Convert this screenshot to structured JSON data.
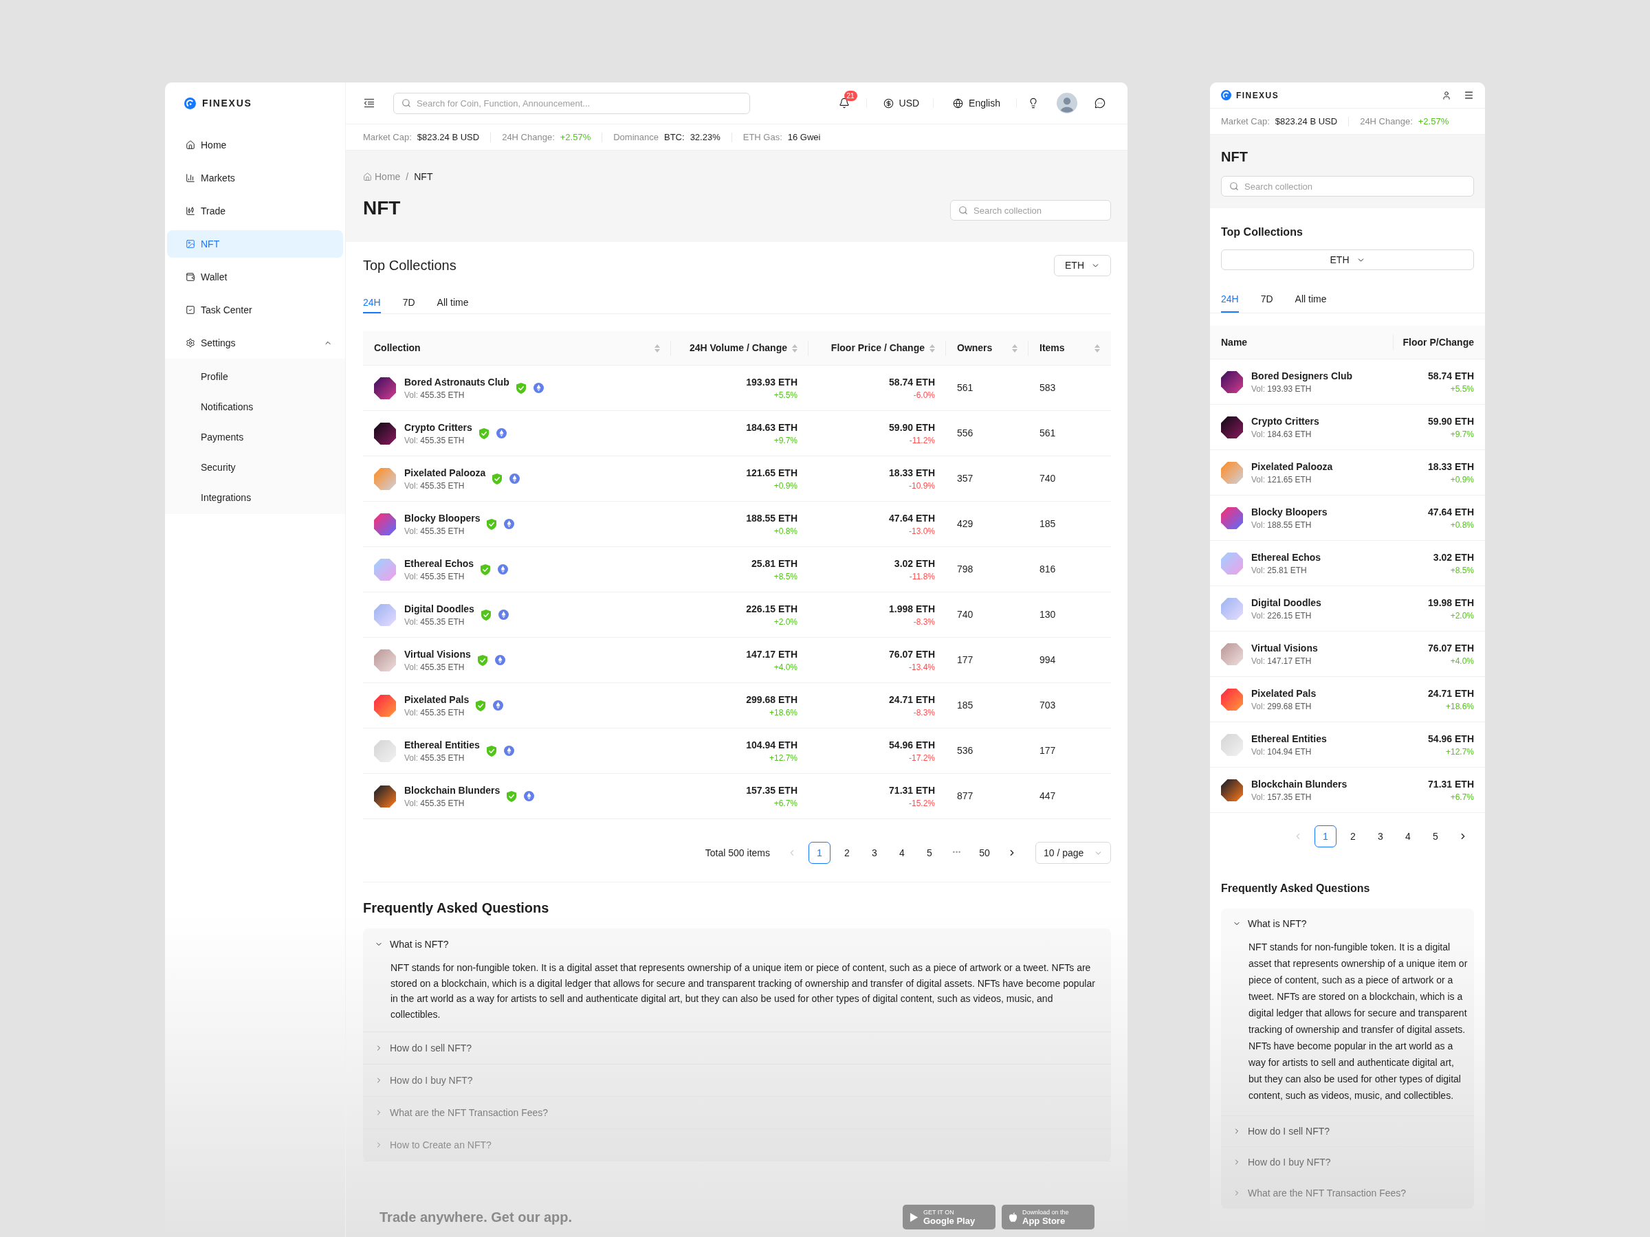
{
  "sidebar": {
    "brand": "FINEXUS",
    "items": [
      {
        "label": "Home",
        "selected": false
      },
      {
        "label": "Markets",
        "selected": false
      },
      {
        "label": "Trade",
        "selected": false
      },
      {
        "label": "NFT",
        "selected": true
      },
      {
        "label": "Wallet",
        "selected": false
      },
      {
        "label": "Task Center",
        "selected": false
      },
      {
        "label": "Settings",
        "selected": false,
        "expanded": true,
        "children": [
          {
            "label": "Profile",
            "selected": false
          },
          {
            "label": "Notifications",
            "selected": false
          },
          {
            "label": "Payments",
            "selected": false
          },
          {
            "label": "Security",
            "selected": false
          },
          {
            "label": "Integrations",
            "selected": false
          }
        ]
      }
    ]
  },
  "topbar": {
    "search": {
      "placeholder": "Search for Coin, Function, Announcement..."
    },
    "notification_count": "21",
    "currency": "USD",
    "language": "English"
  },
  "market_stats": [
    {
      "label": "Market Cap:",
      "value": "$823.24 B USD"
    },
    {
      "label": "24H Change:",
      "value": "+2.57%",
      "positive": true
    },
    {
      "label": "Dominance",
      "sublabel": "BTC:",
      "value": "32.23%"
    },
    {
      "label": "ETH Gas:",
      "value": "16 Gwei"
    }
  ],
  "breadcrumb": {
    "items": [
      {
        "label": "Home"
      },
      {
        "label": "NFT"
      }
    ],
    "separator": "/"
  },
  "page_title": "NFT",
  "collection_search": {
    "placeholder": "Search collection"
  },
  "top_collections": {
    "title": "Top Collections",
    "currency": "ETH",
    "tabs": [
      {
        "label": "24H",
        "selected": true
      },
      {
        "label": "7D",
        "selected": false
      },
      {
        "label": "All time",
        "selected": false
      }
    ],
    "table": {
      "columns": [
        "Collection",
        "24H Volume / Change",
        "Floor Price / Change",
        "Owners",
        "Items"
      ],
      "rows": [
        {
          "name": "Bored Astronauts Club",
          "vol_label": "Vol:",
          "vol": "455.35 ETH",
          "volume": "193.93 ETH",
          "volume_change": "+5.5%",
          "volume_positive": true,
          "floor": "58.74 ETH",
          "floor_change": "-6.0%",
          "floor_positive": false,
          "owners": "561",
          "items": "583"
        },
        {
          "name": "Crypto Critters",
          "vol_label": "Vol:",
          "vol": "455.35 ETH",
          "volume": "184.63 ETH",
          "volume_change": "+9.7%",
          "volume_positive": true,
          "floor": "59.90 ETH",
          "floor_change": "-11.2%",
          "floor_positive": false,
          "owners": "556",
          "items": "561"
        },
        {
          "name": "Pixelated Palooza",
          "vol_label": "Vol:",
          "vol": "455.35 ETH",
          "volume": "121.65 ETH",
          "volume_change": "+0.9%",
          "volume_positive": true,
          "floor": "18.33 ETH",
          "floor_change": "-10.9%",
          "floor_positive": false,
          "owners": "357",
          "items": "740"
        },
        {
          "name": "Blocky Bloopers",
          "vol_label": "Vol:",
          "vol": "455.35 ETH",
          "volume": "188.55 ETH",
          "volume_change": "+0.8%",
          "volume_positive": true,
          "floor": "47.64 ETH",
          "floor_change": "-13.0%",
          "floor_positive": false,
          "owners": "429",
          "items": "185"
        },
        {
          "name": "Ethereal Echos",
          "vol_label": "Vol:",
          "vol": "455.35 ETH",
          "volume": "25.81 ETH",
          "volume_change": "+8.5%",
          "volume_positive": true,
          "floor": "3.02 ETH",
          "floor_change": "-11.8%",
          "floor_positive": false,
          "owners": "798",
          "items": "816"
        },
        {
          "name": "Digital Doodles",
          "vol_label": "Vol:",
          "vol": "455.35 ETH",
          "volume": "226.15 ETH",
          "volume_change": "+2.0%",
          "volume_positive": true,
          "floor": "1.998 ETH",
          "floor_change": "-8.3%",
          "floor_positive": false,
          "owners": "740",
          "items": "130"
        },
        {
          "name": "Virtual Visions",
          "vol_label": "Vol:",
          "vol": "455.35 ETH",
          "volume": "147.17 ETH",
          "volume_change": "+4.0%",
          "volume_positive": true,
          "floor": "76.07 ETH",
          "floor_change": "-13.4%",
          "floor_positive": false,
          "owners": "177",
          "items": "994"
        },
        {
          "name": "Pixelated Pals",
          "vol_label": "Vol:",
          "vol": "455.35 ETH",
          "volume": "299.68 ETH",
          "volume_change": "+18.6%",
          "volume_positive": true,
          "floor": "24.71 ETH",
          "floor_change": "-8.3%",
          "floor_positive": false,
          "owners": "185",
          "items": "703"
        },
        {
          "name": "Ethereal Entities",
          "vol_label": "Vol:",
          "vol": "455.35 ETH",
          "volume": "104.94 ETH",
          "volume_change": "+12.7%",
          "volume_positive": true,
          "floor": "54.96 ETH",
          "floor_change": "-17.2%",
          "floor_positive": false,
          "owners": "536",
          "items": "177"
        },
        {
          "name": "Blockchain Blunders",
          "vol_label": "Vol:",
          "vol": "455.35 ETH",
          "volume": "157.35 ETH",
          "volume_change": "+6.7%",
          "volume_positive": true,
          "floor": "71.31 ETH",
          "floor_change": "-15.2%",
          "floor_positive": false,
          "owners": "877",
          "items": "447"
        }
      ]
    },
    "pagination": {
      "total": "Total 500 items",
      "prev_disabled": true,
      "next_disabled": false,
      "pages": [
        {
          "kind": "page",
          "label": "1",
          "selected": true
        },
        {
          "kind": "page",
          "label": "2",
          "selected": false
        },
        {
          "kind": "page",
          "label": "3",
          "selected": false
        },
        {
          "kind": "page",
          "label": "4",
          "selected": false
        },
        {
          "kind": "page",
          "label": "5",
          "selected": false
        },
        {
          "kind": "ellipsis",
          "label": "•••",
          "selected": false
        },
        {
          "kind": "page",
          "label": "50",
          "selected": false
        }
      ],
      "page_size": "10 / page"
    }
  },
  "faq": {
    "title": "Frequently Asked Questions",
    "items": [
      {
        "question": "What is NFT?",
        "expanded": true,
        "answer": "NFT stands for non-fungible token. It is a digital asset that represents ownership of a unique item or piece of content, such as a piece of artwork or a tweet. NFTs are stored on a blockchain, which is a digital ledger that allows for secure and transparent tracking of ownership and transfer of digital assets. NFTs have become popular in the art world as a way for artists to sell and authenticate digital art, but they can also be used for other types of digital content, such as videos, music, and collectibles."
      },
      {
        "question": "How do I sell NFT?",
        "expanded": false
      },
      {
        "question": "How do I buy NFT?",
        "expanded": false
      },
      {
        "question": "What are the NFT Transaction Fees?",
        "expanded": false
      },
      {
        "question": "How to Create an NFT?",
        "expanded": false
      }
    ]
  },
  "app_promo": {
    "text": "Trade anywhere. Get our app.",
    "badges": [
      {
        "kind": "google_play",
        "caption": "GET IT ON",
        "store": "Google Play"
      },
      {
        "kind": "app_store",
        "caption": "Download on the",
        "store": "App Store"
      }
    ]
  },
  "mobile": {
    "brand": "FINEXUS",
    "market_stats": [
      {
        "label": "Market Cap:",
        "value": "$823.24 B USD"
      },
      {
        "label": "24H Change:",
        "value": "+2.57%",
        "positive": true
      }
    ],
    "page_title": "NFT",
    "search": {
      "placeholder": "Search collection"
    },
    "top_collections": {
      "title": "Top Collections",
      "currency": "ETH",
      "tabs": [
        {
          "label": "24H",
          "selected": true
        },
        {
          "label": "7D",
          "selected": false
        },
        {
          "label": "All time",
          "selected": false
        }
      ],
      "columns": [
        "Name",
        "Floor P/Change"
      ],
      "rows": [
        {
          "name": "Bored Designers Club",
          "vol_label": "Vol:",
          "vol": "193.93 ETH",
          "floor": "58.74 ETH",
          "change": "+5.5%",
          "positive": true
        },
        {
          "name": "Crypto Critters",
          "vol_label": "Vol:",
          "vol": "184.63 ETH",
          "floor": "59.90 ETH",
          "change": "+9.7%",
          "positive": true
        },
        {
          "name": "Pixelated Palooza",
          "vol_label": "Vol:",
          "vol": "121.65 ETH",
          "floor": "18.33 ETH",
          "change": "+0.9%",
          "positive": true
        },
        {
          "name": "Blocky Bloopers",
          "vol_label": "Vol:",
          "vol": "188.55 ETH",
          "floor": "47.64 ETH",
          "change": "+0.8%",
          "positive": true
        },
        {
          "name": "Ethereal Echos",
          "vol_label": "Vol:",
          "vol": "25.81 ETH",
          "floor": "3.02 ETH",
          "change": "+8.5%",
          "positive": true
        },
        {
          "name": "Digital Doodles",
          "vol_label": "Vol:",
          "vol": "226.15 ETH",
          "floor": "19.98 ETH",
          "change": "+2.0%",
          "positive": true
        },
        {
          "name": "Virtual Visions",
          "vol_label": "Vol:",
          "vol": "147.17 ETH",
          "floor": "76.07 ETH",
          "change": "+4.0%",
          "positive": true
        },
        {
          "name": "Pixelated Pals",
          "vol_label": "Vol:",
          "vol": "299.68 ETH",
          "floor": "24.71 ETH",
          "change": "+18.6%",
          "positive": true
        },
        {
          "name": "Ethereal Entities",
          "vol_label": "Vol:",
          "vol": "104.94 ETH",
          "floor": "54.96 ETH",
          "change": "+12.7%",
          "positive": true
        },
        {
          "name": "Blockchain Blunders",
          "vol_label": "Vol:",
          "vol": "157.35 ETH",
          "floor": "71.31 ETH",
          "change": "+6.7%",
          "positive": true
        }
      ],
      "pagination": {
        "prev_disabled": true,
        "next_disabled": false,
        "pages": [
          {
            "kind": "page",
            "label": "1",
            "selected": true
          },
          {
            "kind": "page",
            "label": "2",
            "selected": false
          },
          {
            "kind": "page",
            "label": "3",
            "selected": false
          },
          {
            "kind": "page",
            "label": "4",
            "selected": false
          },
          {
            "kind": "page",
            "label": "5",
            "selected": false
          }
        ]
      }
    },
    "faq": {
      "title": "Frequently Asked Questions",
      "items": [
        {
          "question": "What is NFT?",
          "expanded": true,
          "answer": "NFT stands for non-fungible token. It is a digital asset that represents ownership of a unique item or piece of content, such as a piece of artwork or a tweet. NFTs are stored on a blockchain, which is a digital ledger that allows for secure and transparent tracking of ownership and transfer of digital assets. NFTs have become popular in the art world as a way for artists to sell and authenticate digital art, but they can also be used for other types of digital content, such as videos, music, and collectibles."
        },
        {
          "question": "How do I sell NFT?",
          "expanded": false
        },
        {
          "question": "How do I buy NFT?",
          "expanded": false
        },
        {
          "question": "What are the NFT Transaction Fees?",
          "expanded": false
        }
      ]
    }
  }
}
